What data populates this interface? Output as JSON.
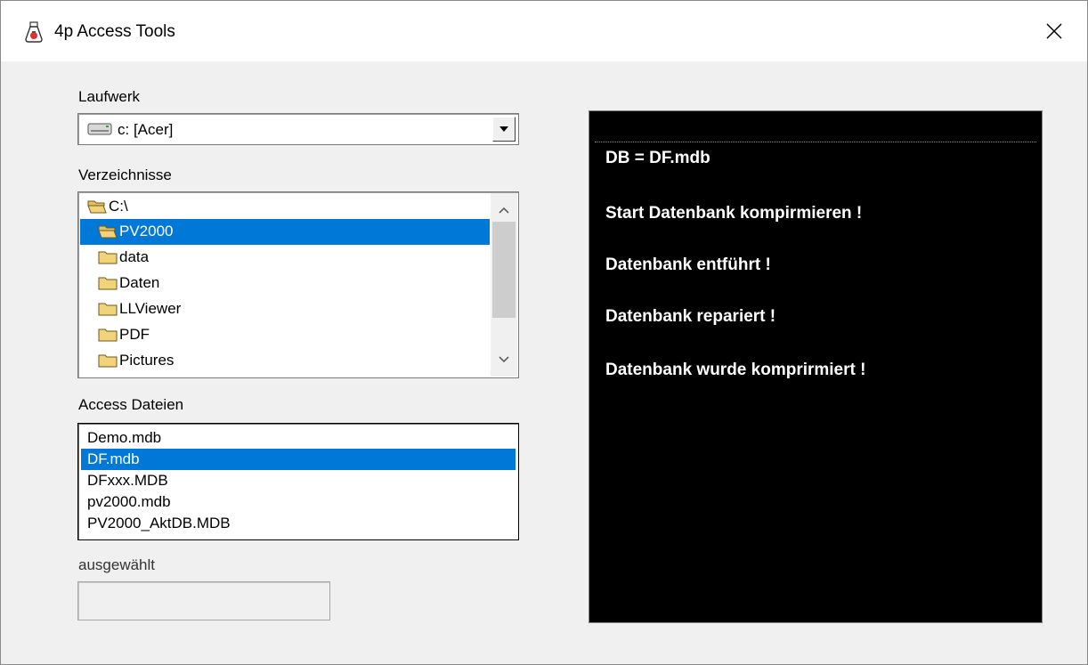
{
  "window": {
    "title": "4p Access Tools",
    "close_glyph": "✕",
    "app_icon": "flask-icon"
  },
  "drive": {
    "label": "Laufwerk",
    "value": "c: [Acer]",
    "icon": "drive-icon"
  },
  "directories": {
    "label": "Verzeichnisse",
    "items": [
      {
        "label": "C:\\",
        "icon": "open-folder-icon"
      },
      {
        "label": "PV2000",
        "icon": "open-folder-icon"
      },
      {
        "label": "data",
        "icon": "folder-icon"
      },
      {
        "label": "Daten",
        "icon": "folder-icon"
      },
      {
        "label": "LLViewer",
        "icon": "folder-icon"
      },
      {
        "label": "PDF",
        "icon": "folder-icon"
      },
      {
        "label": "Pictures",
        "icon": "folder-icon"
      }
    ],
    "selected": "PV2000"
  },
  "files": {
    "label": "Access Dateien",
    "items": [
      "Demo.mdb",
      "DF.mdb",
      "DFxxx.MDB",
      "pv2000.mdb",
      "PV2000_AktDB.MDB"
    ],
    "selected": "DF.mdb"
  },
  "selection": {
    "label": "ausgewählt",
    "value": ""
  },
  "log": {
    "lines": [
      "DB = DF.mdb",
      "Start Datenbank kompirmieren !",
      "Datenbank entführt !",
      "Datenbank repariert !",
      "Datenbank wurde komprirmiert !"
    ]
  },
  "colors": {
    "selection": "#0078d7",
    "log_background": "#000000",
    "log_text": "#ffffff",
    "folder": "#f3d37a"
  }
}
